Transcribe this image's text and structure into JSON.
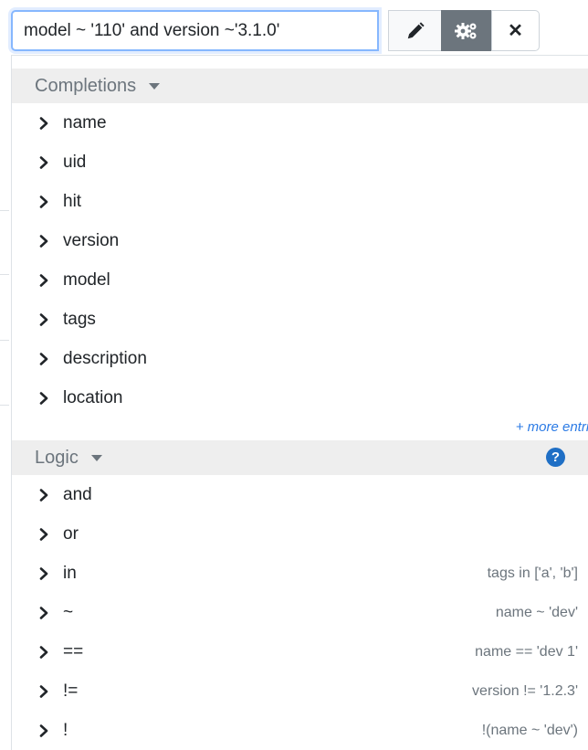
{
  "search": {
    "value": "model ~ '110' and version ~'3.1.0'"
  },
  "toolbar": {
    "edit_icon": "pencil-icon",
    "settings_icon": "cogs-icon",
    "close_icon": "close-icon",
    "close_glyph": "✕",
    "accent": "#6c757d"
  },
  "completions": {
    "title": "Completions",
    "items": [
      {
        "label": "name"
      },
      {
        "label": "uid"
      },
      {
        "label": "hit"
      },
      {
        "label": "version"
      },
      {
        "label": "model"
      },
      {
        "label": "tags"
      },
      {
        "label": "description"
      },
      {
        "label": "location"
      }
    ],
    "more_label": "+ more entries"
  },
  "logic": {
    "title": "Logic",
    "help_glyph": "?",
    "items": [
      {
        "label": "and",
        "example": ""
      },
      {
        "label": "or",
        "example": ""
      },
      {
        "label": "in",
        "example": "tags in ['a', 'b']"
      },
      {
        "label": "~",
        "example": "name ~ 'dev'"
      },
      {
        "label": "==",
        "example": "name == 'dev 1'"
      },
      {
        "label": "!=",
        "example": "version != '1.2.3'"
      },
      {
        "label": "!",
        "example": "!(name ~ 'dev')"
      }
    ]
  }
}
